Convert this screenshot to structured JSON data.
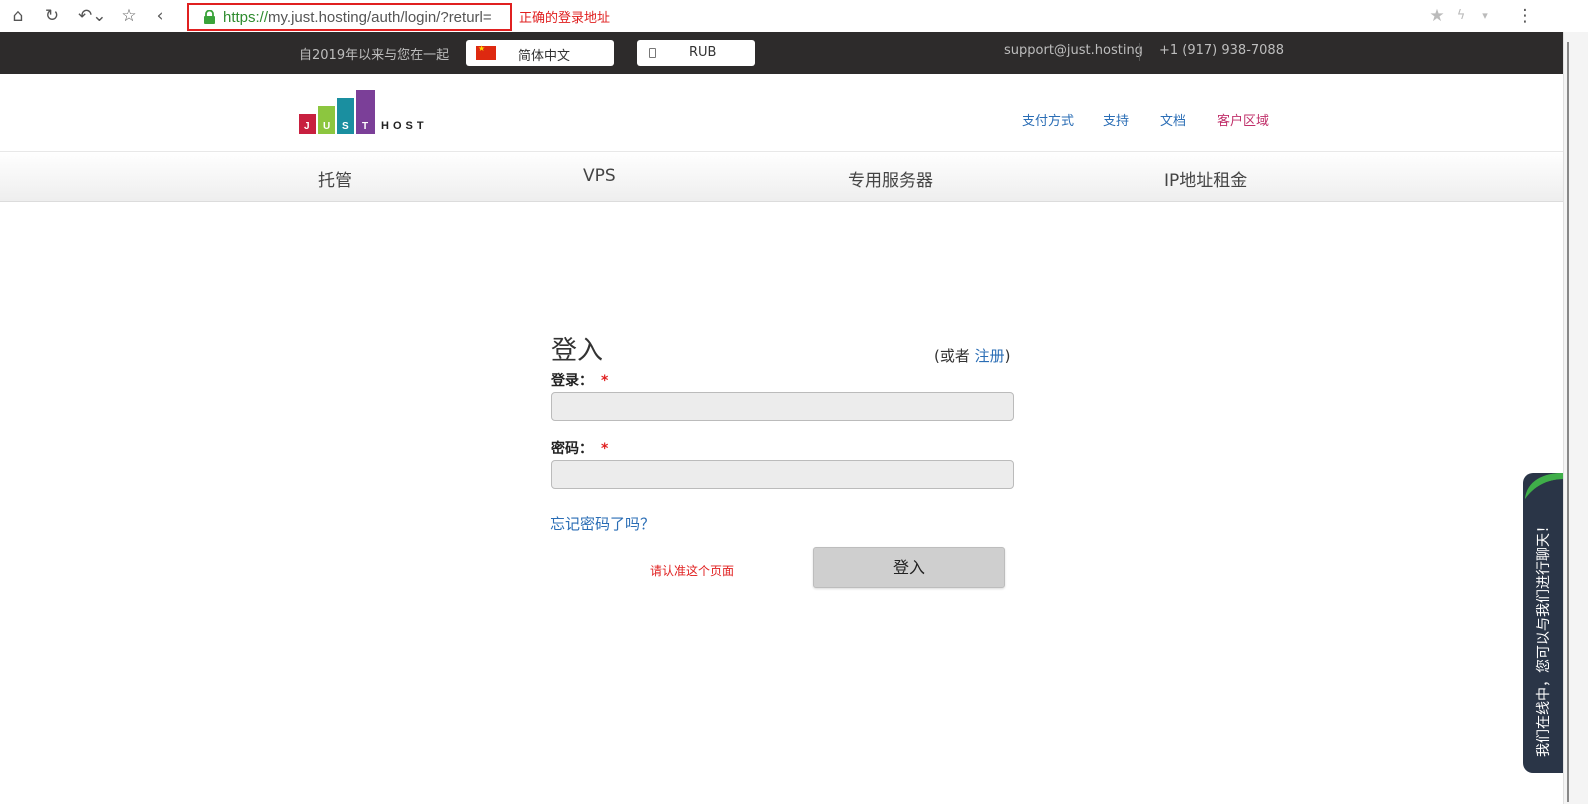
{
  "browser": {
    "url_protocol": "https://",
    "url_rest": "my.just.hosting/auth/login/?returl=",
    "annotation": "正确的登录地址",
    "icons": [
      "home-icon",
      "reload-icon",
      "undo-icon",
      "star-icon",
      "back-icon",
      "lock-icon",
      "bookmark-star-icon",
      "lightning-icon",
      "dropdown-icon",
      "menu-dots-icon"
    ]
  },
  "topbar": {
    "since": "自2019年以来与您在一起",
    "language": "简体中文",
    "currency": "RUB",
    "support_email": "support@just.hosting",
    "phone": "+1 (917) 938-7088"
  },
  "logo": {
    "letters": [
      "J",
      "U",
      "S",
      "T"
    ],
    "word": "HOST",
    "colors": [
      "#c8203f",
      "#8cc63f",
      "#1a8fa0",
      "#7b3f98"
    ]
  },
  "header_links": {
    "payment": "支付方式",
    "support": "支持",
    "docs": "文档",
    "client_area": "客户区域"
  },
  "menu": {
    "hosting": "托管",
    "vps": "VPS",
    "dedicated": "专用服务器",
    "ip_rent": "IP地址租金"
  },
  "login": {
    "title": "登入",
    "or_prefix": "(或者 ",
    "register": "注册",
    "or_suffix": ")",
    "login_label": "登录：",
    "password_label": "密码：",
    "required_mark": "*",
    "forgot": "忘记密码了吗？",
    "confirm_note": "请认准这个页面",
    "submit": "登入"
  },
  "chat": {
    "text": "我们在线中，您可以与我们进行聊天！"
  }
}
